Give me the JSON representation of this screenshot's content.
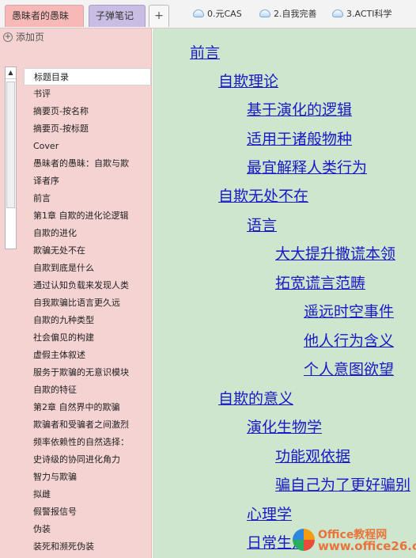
{
  "tabstrip": {
    "notebook_tabs": [
      "愚昧者的愚昧",
      "子弹笔记"
    ],
    "add_tab_label": "+",
    "browser_tabs": [
      "0.元CAS",
      "2.自我完善",
      "3.ACTI科学"
    ]
  },
  "sidebar": {
    "add_page_label": "添加页",
    "add_page_icon": "plus-circle-icon",
    "pages": [
      "标题目录",
      "书评",
      "摘要页-按名称",
      "摘要页-按标题",
      "Cover",
      "愚昧者的愚昧：自欺与欺",
      "译者序",
      "前言",
      "第1章  自欺的进化论逻辑",
      "自欺的进化",
      "欺骗无处不在",
      "自欺到底是什么",
      "通过认知负载来发现人类",
      "自我欺骗比语言更久远",
      "自欺的九种类型",
      "社会偏见的构建",
      "虚假主体叙述",
      "服务于欺骗的无意识模块",
      "自欺的特征",
      "第2章  自然界中的欺骗",
      "欺骗者和受骗者之间激烈",
      "频率依赖性的自然选择：",
      "史诗级的协同进化角力",
      "智力与欺骗",
      "拟雌",
      "假警报信号",
      "伪装",
      "装死和濒死伪装"
    ]
  },
  "content": {
    "toc": [
      "前言",
      "自欺理论",
      "基于演化的逻辑",
      "适用于诸般物种",
      "最宜解释人类行为",
      "自欺无处不在",
      "语言",
      "大大提升撒谎本领",
      "拓宽谎言范畴",
      "遥远时空事件",
      "他人行为含义",
      "个人意图欲望",
      "自欺的意义",
      "演化生物学",
      "功能观依据",
      "骗自己为了更好骗别",
      "心理学",
      "日常生活"
    ]
  },
  "watermark": {
    "line1": "Office教程网",
    "line2": "www.office26.com"
  },
  "colors": {
    "sidebar_bg": "#f5d3d3",
    "content_bg": "#cde6cd",
    "link": "#1919c8",
    "active_tab": "#f7b8b8",
    "second_tab": "#c9bde4"
  }
}
